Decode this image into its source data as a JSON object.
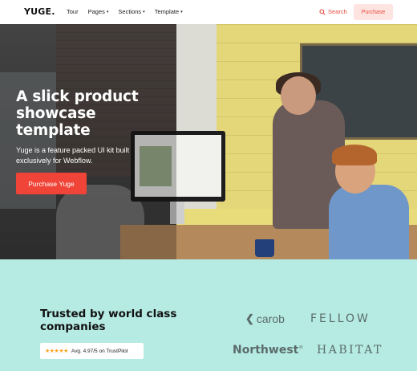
{
  "nav": {
    "logo": "YUGE.",
    "links": [
      {
        "label": "Tour",
        "caret": ""
      },
      {
        "label": "Pages",
        "caret": "▾"
      },
      {
        "label": "Sections",
        "caret": "▾"
      },
      {
        "label": "Template",
        "caret": "▾"
      }
    ],
    "search_label": "Search",
    "purchase_label": "Purchase",
    "accent_color": "#e84b3c"
  },
  "hero": {
    "title": "A slick product showcase template",
    "subtitle": "Yuge is a feature packed UI kit built exclusively for Webflow.",
    "cta_label": "Purchase Yuge",
    "cta_color": "#ef4437"
  },
  "trusted": {
    "title": "Trusted by world class companies",
    "stars": "★★★★★",
    "rating_text": "Avg. 4.97/5 on TrustPilot",
    "background": "#b6ebe4",
    "logos": {
      "carob": "carob",
      "fellow": "FELLOW",
      "northwest": "Northwest",
      "northwest_mark": "®",
      "habitat": "HABITAT"
    }
  }
}
